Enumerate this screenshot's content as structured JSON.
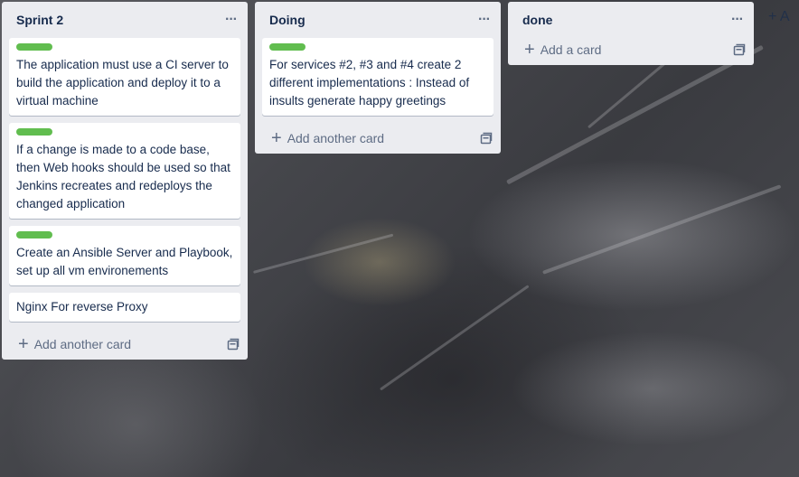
{
  "lists": [
    {
      "title": "Sprint 2",
      "cards": [
        {
          "has_label": true,
          "text": "The application must use a CI server to build the application and deploy it to a virtual machine"
        },
        {
          "has_label": true,
          "text": "If a change is made to a code base, then Web hooks should be used so that Jenkins recreates and redeploys the changed application"
        },
        {
          "has_label": true,
          "text": "Create an Ansible Server and Playbook, set up all vm environements"
        },
        {
          "has_label": false,
          "text": "Nginx For reverse Proxy"
        }
      ],
      "add_label": "Add another card"
    },
    {
      "title": "Doing",
      "cards": [
        {
          "has_label": true,
          "text": "For services #2, #3 and #4 create 2 different implementations : Instead of insults generate happy greetings"
        }
      ],
      "add_label": "Add another card"
    },
    {
      "title": "done",
      "cards": [],
      "add_label": "Add a card"
    }
  ],
  "menu_glyph": "···",
  "plus_glyph": "+",
  "partial_add_list": "+ A",
  "colors": {
    "label_green": "#61bd4f",
    "list_bg": "#ebecf0",
    "text": "#172b4d"
  }
}
